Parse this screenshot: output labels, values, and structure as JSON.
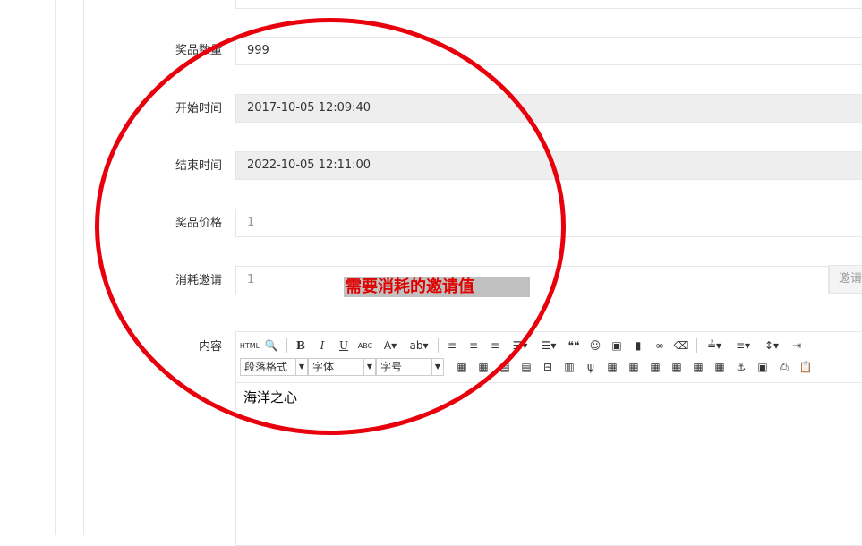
{
  "form": {
    "top_field_value": "",
    "quantity": {
      "label": "奖品数量",
      "value": "999"
    },
    "start_time": {
      "label": "开始时间",
      "value": "2017-10-05 12:09:40"
    },
    "end_time": {
      "label": "结束时间",
      "value": "2022-10-05 12:11:00"
    },
    "price": {
      "label": "奖品价格",
      "placeholder": "1"
    },
    "invite_cost": {
      "label": "消耗邀请",
      "placeholder": "1",
      "addon": "邀请"
    },
    "content": {
      "label": "内容",
      "text": "海洋之心"
    }
  },
  "annotation": {
    "text": "需要消耗的邀请值",
    "color": "#e00000",
    "circle_color": "#e8000c"
  },
  "editor_toolbar": {
    "row1": [
      {
        "icon": "html-icon",
        "text": "HTML"
      },
      {
        "icon": "preview-icon",
        "text": "🔍"
      },
      {
        "icon": "bold-icon",
        "text": "B"
      },
      {
        "icon": "italic-icon",
        "text": "I"
      },
      {
        "icon": "underline-icon",
        "text": "U"
      },
      {
        "icon": "strikethrough-icon",
        "text": "ABC"
      },
      {
        "icon": "font-color-icon",
        "text": "A▾"
      },
      {
        "icon": "highlight-icon",
        "text": "ab▾"
      },
      {
        "icon": "align-left-icon",
        "text": "≡"
      },
      {
        "icon": "align-center-icon",
        "text": "≡"
      },
      {
        "icon": "align-right-icon",
        "text": "≡"
      },
      {
        "icon": "ordered-list-icon",
        "text": "☰▾"
      },
      {
        "icon": "unordered-list-icon",
        "text": "☰▾"
      },
      {
        "icon": "blockquote-icon",
        "text": "❝❝"
      },
      {
        "icon": "emoji-icon",
        "text": "☺"
      },
      {
        "icon": "image-icon",
        "text": "▣"
      },
      {
        "icon": "video-icon",
        "text": "▮"
      },
      {
        "icon": "link-icon",
        "text": "∞"
      },
      {
        "icon": "eraser-icon",
        "text": "⌫"
      },
      {
        "icon": "paragraph-spacing-top-icon",
        "text": "≟▾"
      },
      {
        "icon": "paragraph-spacing-bottom-icon",
        "text": "≡▾"
      },
      {
        "icon": "line-height-icon",
        "text": "↕▾"
      },
      {
        "icon": "indent-icon",
        "text": "⇥"
      }
    ],
    "row2_combos": {
      "paragraph": "段落格式",
      "font": "字体",
      "size": "字号"
    },
    "row2": [
      {
        "icon": "table-icon",
        "text": "▦"
      },
      {
        "icon": "delete-table-icon",
        "text": "▦"
      },
      {
        "icon": "insert-row-before-icon",
        "text": "▤"
      },
      {
        "icon": "insert-row-after-icon",
        "text": "▤"
      },
      {
        "icon": "delete-row-icon",
        "text": "⊟"
      },
      {
        "icon": "insert-col-before-icon",
        "text": "▥"
      },
      {
        "icon": "delete-col-icon",
        "text": "ψ"
      },
      {
        "icon": "merge-cells-icon",
        "text": "▦"
      },
      {
        "icon": "merge-right-icon",
        "text": "▦"
      },
      {
        "icon": "merge-down-icon",
        "text": "▦"
      },
      {
        "icon": "split-cells-icon",
        "text": "▦"
      },
      {
        "icon": "split-rows-icon",
        "text": "▦"
      },
      {
        "icon": "split-cols-icon",
        "text": "▦"
      },
      {
        "icon": "anchor-icon",
        "text": "⚓"
      },
      {
        "icon": "insert-frame-icon",
        "text": "▣"
      },
      {
        "icon": "print-icon",
        "text": "⎙"
      },
      {
        "icon": "paste-icon",
        "text": "📋"
      }
    ]
  }
}
